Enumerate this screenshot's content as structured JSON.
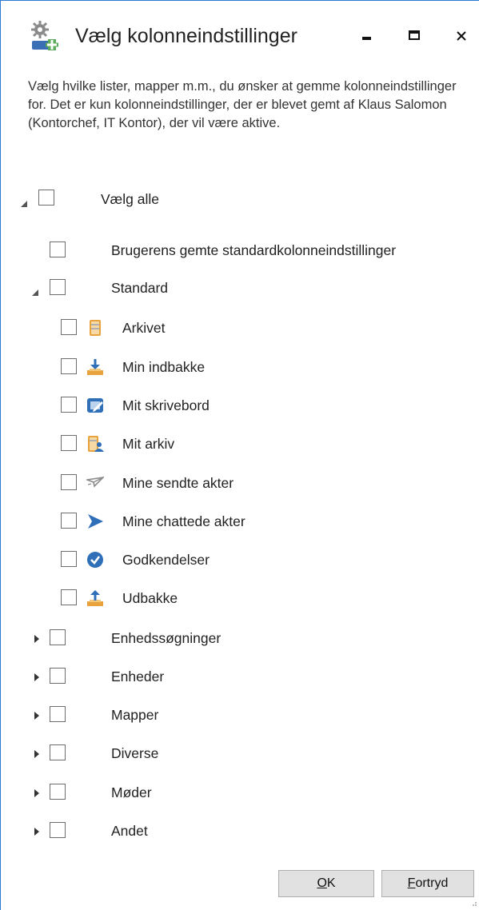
{
  "window": {
    "title": "Vælg kolonneindstillinger",
    "description": "Vælg hvilke lister, mapper m.m., du ønsker at gemme kolonneindstillinger for. Det er kun kolonneindstillinger, der er blevet gemt af Klaus Salomon (Kontorchef, IT Kontor), der vil være aktive."
  },
  "tree": {
    "select_all": "Vælg alle",
    "saved_defaults": "Brugerens gemte standardkolonneindstillinger",
    "standard": {
      "label": "Standard",
      "items": [
        {
          "label": "Arkivet",
          "icon": "archive-icon"
        },
        {
          "label": "Min indbakke",
          "icon": "inbox-icon"
        },
        {
          "label": "Mit skrivebord",
          "icon": "desk-icon"
        },
        {
          "label": "Mit arkiv",
          "icon": "my-archive-icon"
        },
        {
          "label": "Mine sendte akter",
          "icon": "sent-icon"
        },
        {
          "label": "Mine chattede akter",
          "icon": "chat-send-icon"
        },
        {
          "label": "Godkendelser",
          "icon": "approval-check-icon"
        },
        {
          "label": "Udbakke",
          "icon": "outbox-icon"
        }
      ]
    },
    "groups": [
      {
        "label": "Enhedssøgninger"
      },
      {
        "label": "Enheder"
      },
      {
        "label": "Mapper"
      },
      {
        "label": "Diverse"
      },
      {
        "label": "Møder"
      },
      {
        "label": "Andet"
      }
    ]
  },
  "buttons": {
    "ok_mnemonic": "O",
    "ok_rest": "K",
    "cancel_mnemonic": "F",
    "cancel_rest": "ortryd"
  },
  "colors": {
    "accent_border": "#2b7bd6",
    "icon_blue": "#2f6fb8",
    "icon_orange": "#e8a33d"
  }
}
